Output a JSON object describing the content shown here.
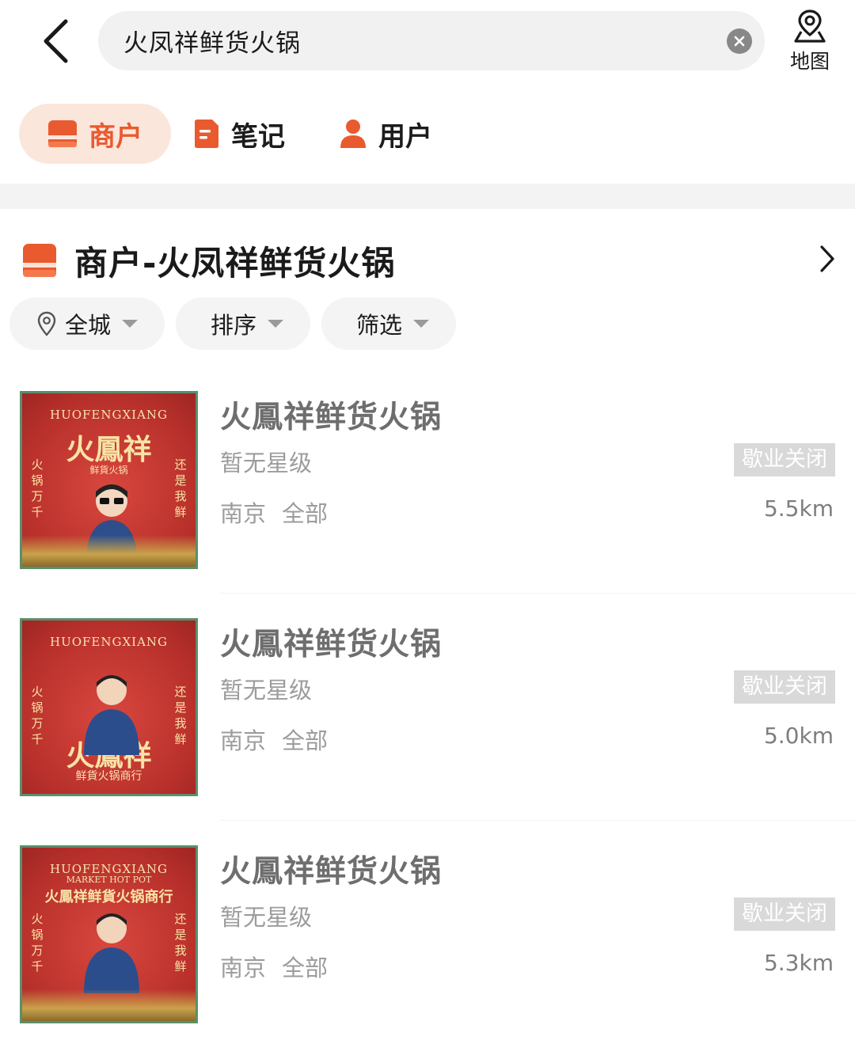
{
  "header": {
    "search_value": "火凤祥鲜货火锅",
    "map_label": "地图"
  },
  "tabs": [
    {
      "label": "商户",
      "active": true,
      "icon": "shop-icon"
    },
    {
      "label": "笔记",
      "active": false,
      "icon": "note-icon"
    },
    {
      "label": "用户",
      "active": false,
      "icon": "user-icon"
    }
  ],
  "section": {
    "title": "商户-火凤祥鲜货火锅"
  },
  "filters": [
    {
      "label": "全城",
      "icon": "location-pin-icon"
    },
    {
      "label": "排序"
    },
    {
      "label": "筛选"
    }
  ],
  "items": [
    {
      "name": "火鳳祥鲜货火锅",
      "stars": "暂无星级",
      "city": "南京",
      "category": "全部",
      "status": "歇业关闭",
      "distance": "5.5km",
      "poster_en": "HUOFENGXIANG",
      "poster_cn": "火鳳祥",
      "poster_sub": "鲜貨火锅",
      "poster_left": "火锅万千",
      "poster_right": "还是我鲜"
    },
    {
      "name": "火鳳祥鲜货火锅",
      "stars": "暂无星级",
      "city": "南京",
      "category": "全部",
      "status": "歇业关闭",
      "distance": "5.0km",
      "poster_en": "HUOFENGXIANG",
      "poster_cn": "火鳳祥",
      "poster_sub": "鲜貨火锅商行",
      "poster_left": "火锅万千",
      "poster_right": "还是我鲜"
    },
    {
      "name": "火鳳祥鲜货火锅",
      "stars": "暂无星级",
      "city": "南京",
      "category": "全部",
      "status": "歇业关闭",
      "distance": "5.3km",
      "poster_en": "HUOFENGXIANG",
      "poster_cn": "火鳳祥鲜貨火锅商行",
      "poster_sub": "MARKET HOT POT",
      "poster_left": "火锅万千",
      "poster_right": "还是我鲜"
    }
  ],
  "colors": {
    "accent": "#ea5a2f",
    "accent_bg": "#fbe6dc",
    "status_bg": "#d9d9d9"
  }
}
